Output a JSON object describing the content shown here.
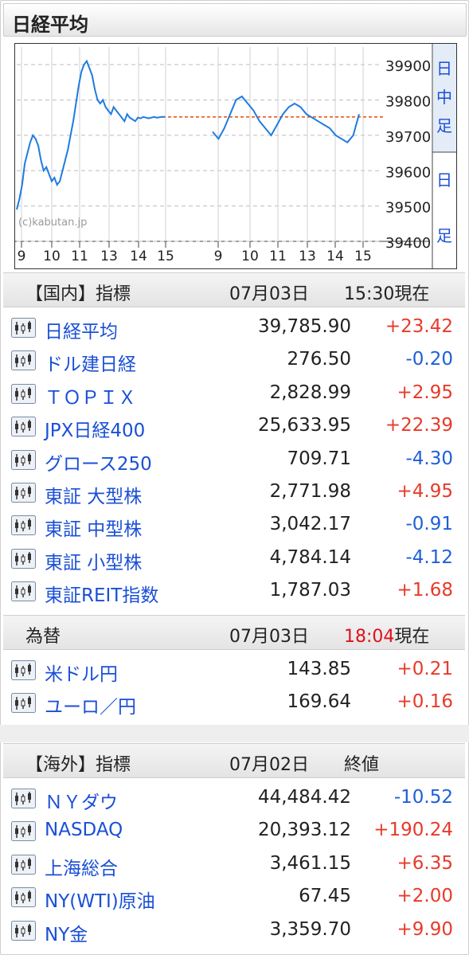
{
  "title": "日経平均",
  "chart_data": {
    "type": "line",
    "y_ticks": [
      "39900",
      "39800",
      "39700",
      "39600",
      "39500",
      "39400"
    ],
    "ylim": [
      39400,
      39950
    ],
    "x_ticks": [
      "9",
      "10",
      "11",
      "13",
      "14",
      "15",
      "9",
      "10",
      "11",
      "13",
      "14",
      "15"
    ],
    "reference_line": 39752,
    "side_labels": {
      "top": [
        "日",
        "中",
        "足"
      ],
      "bottom": [
        "日",
        "足"
      ]
    },
    "watermark": "(c)kabutan.jp",
    "colors": {
      "line": "#1e7be0",
      "reference": "#e85a1a",
      "grid": "#bdbdbd"
    },
    "series": [
      {
        "x": [
          0,
          0.1,
          0.2,
          0.3,
          0.4,
          0.5,
          0.6,
          0.7,
          0.8,
          0.9,
          1.0,
          1.1,
          1.2,
          1.3,
          1.4,
          1.5,
          1.6,
          1.7,
          1.8,
          1.9,
          2.0,
          2.1,
          2.2,
          2.3,
          2.4,
          2.5,
          2.6,
          2.7,
          2.8,
          2.9,
          3.0,
          3.1,
          3.2,
          3.3,
          3.4,
          3.5,
          3.6,
          3.7,
          3.8,
          3.9,
          4.0,
          4.1,
          4.2,
          4.3,
          4.4,
          4.5,
          4.6,
          4.7,
          4.8,
          4.9,
          5.0,
          5.1,
          5.2,
          5.3,
          5.4,
          5.5
        ],
        "y": [
          39490,
          39520,
          39560,
          39620,
          39650,
          39680,
          39700,
          39690,
          39670,
          39630,
          39600,
          39610,
          39590,
          39570,
          39580,
          39560,
          39570,
          39600,
          39630,
          39660,
          39700,
          39740,
          39790,
          39840,
          39880,
          39900,
          39910,
          39890,
          39870,
          39830,
          39800,
          39790,
          39800,
          39780,
          39770,
          39760,
          39780,
          39770,
          39760,
          39750,
          39740,
          39760,
          39750,
          39745,
          39740,
          39750,
          39748,
          39752,
          39750,
          39748,
          39750,
          39752,
          39750,
          39751,
          39752,
          39752
        ]
      }
    ]
  },
  "domestic": {
    "label": "【国内】指標",
    "date": "07月03日",
    "time": "15:30現在",
    "rows": [
      {
        "name": "日経平均",
        "value": "39,785.90",
        "change": "+23.42"
      },
      {
        "name": "ドル建日経",
        "value": "276.50",
        "change": "-0.20"
      },
      {
        "name": "ＴＯＰＩＸ",
        "value": "2,828.99",
        "change": "+2.95"
      },
      {
        "name": "JPX日経400",
        "value": "25,633.95",
        "change": "+22.39"
      },
      {
        "name": "グロース250",
        "value": "709.71",
        "change": "-4.30"
      },
      {
        "name": "東証 大型株",
        "value": "2,771.98",
        "change": "+4.95"
      },
      {
        "name": "東証 中型株",
        "value": "3,042.17",
        "change": "-0.91"
      },
      {
        "name": "東証 小型株",
        "value": "4,784.14",
        "change": "-4.12"
      },
      {
        "name": "東証REIT指数",
        "value": "1,787.03",
        "change": "+1.68"
      }
    ]
  },
  "fx": {
    "label": "為替",
    "date": "07月03日",
    "time_red": "18:04",
    "time_suffix": "現在",
    "rows": [
      {
        "name": "米ドル円",
        "value": "143.85",
        "change": "+0.21"
      },
      {
        "name": "ユーロ／円",
        "value": "169.64",
        "change": "+0.16"
      }
    ]
  },
  "overseas": {
    "label": "【海外】指標",
    "date": "07月02日",
    "time": "終値",
    "rows": [
      {
        "name": "ＮＹダウ",
        "value": "44,484.42",
        "change": "-10.52"
      },
      {
        "name": "NASDAQ",
        "value": "20,393.12",
        "change": "+190.24"
      },
      {
        "name": "上海総合",
        "value": "3,461.15",
        "change": "+6.35"
      },
      {
        "name": "NY(WTI)原油",
        "value": "67.45",
        "change": "+2.00"
      },
      {
        "name": "NY金",
        "value": "3,359.70",
        "change": "+9.90"
      }
    ]
  }
}
